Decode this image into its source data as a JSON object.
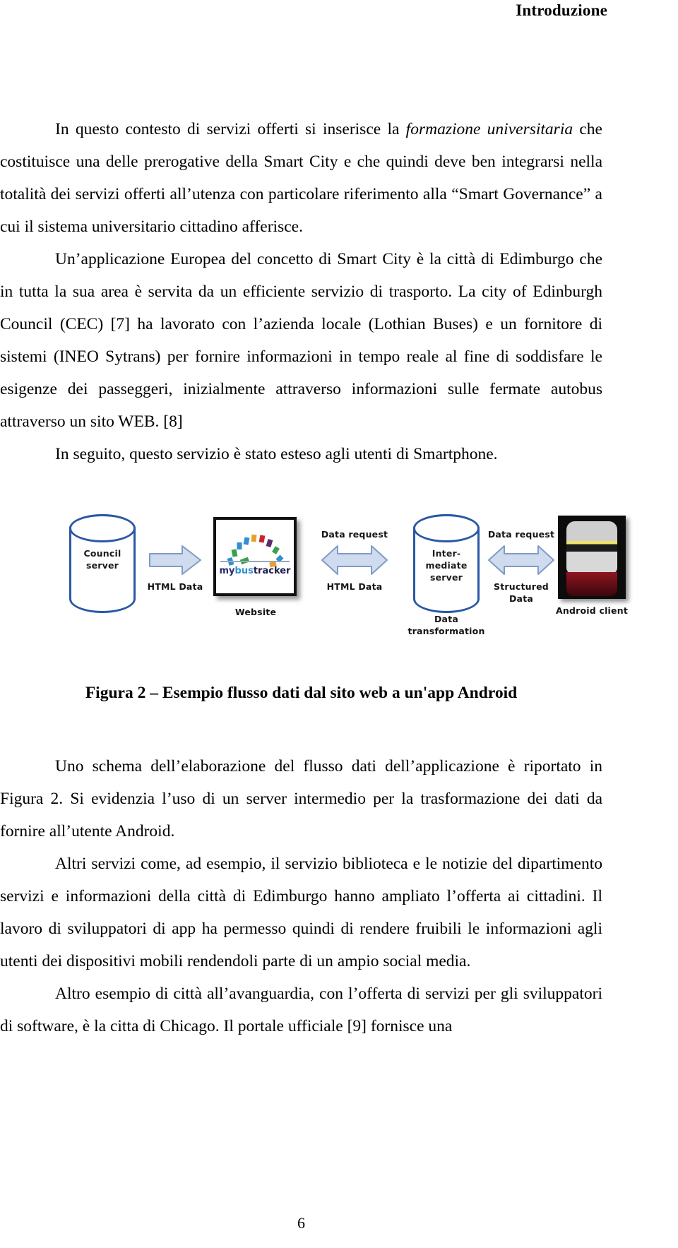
{
  "header": {
    "title": "Introduzione"
  },
  "main": {
    "paragraphs": [
      {
        "id": "p1",
        "indent": true,
        "runs": [
          {
            "text": "In questo contesto di servizi offerti si inserisce la ",
            "style": "normal"
          },
          {
            "text": "formazione universitaria",
            "style": "italic"
          },
          {
            "text": " che costituisce una delle prerogative della Smart City e che quindi deve ben integrarsi nella totalità dei servizi offerti all’utenza con particolare riferimento alla “Smart Governance” a cui il sistema universitario cittadino afferisce.",
            "style": "normal"
          }
        ]
      },
      {
        "id": "p2",
        "indent": true,
        "runs": [
          {
            "text": "Un’applicazione Europea del concetto di Smart City è la città di Edimburgo che in tutta la sua area è servita da un efficiente servizio di trasporto. La city of Edinburgh Council (CEC) [7] ha lavorato con l’azienda locale (Lothian Buses) e un fornitore di sistemi (INEO Sytrans) per fornire informazioni in tempo reale al fine di soddisfare le esigenze dei passeggeri, inizialmente attraverso informazioni sulle fermate autobus attraverso un sito WEB. [8]",
            "style": "normal"
          }
        ]
      },
      {
        "id": "p3",
        "indent": true,
        "runs": [
          {
            "text": "In seguito, questo servizio è stato esteso agli utenti di Smartphone.",
            "style": "normal"
          }
        ]
      }
    ]
  },
  "figure": {
    "caption": "Figura 2 – Esempio flusso dati dal sito web a un'app Android",
    "nodes": {
      "council_server": "Council\nserver",
      "website_label": "Website",
      "intermediate_server": "Inter-\nmediate\nserver",
      "android_client": "Android client",
      "data_transformation": "Data\ntransformation",
      "logo_my": "my",
      "logo_bus": "bus",
      "logo_tracker": "tracker"
    },
    "edges": {
      "edge1_below": "HTML Data",
      "edge2_above": "Data request",
      "edge2_below": "HTML Data",
      "edge3_above": "Data request",
      "edge3_below": "Structured\nData"
    },
    "colors": {
      "cylinder_stroke": "#2a58a5",
      "arrow_fill": "#cfdcef",
      "arrow_stroke": "#7e9cc4",
      "logo_blue": "#2f8fd0",
      "logo_navy": "#2b2b6e"
    }
  },
  "main2": {
    "paragraphs": [
      {
        "id": "p4",
        "indent": true,
        "runs": [
          {
            "text": "Uno schema dell’elaborazione del flusso dati dell’applicazione è riportato in Figura 2. Si evidenzia l’uso di un server intermedio per la trasformazione dei dati da fornire all’utente Android.",
            "style": "normal"
          }
        ]
      },
      {
        "id": "p5",
        "indent": true,
        "runs": [
          {
            "text": "Altri servizi come, ad esempio, il servizio biblioteca e le notizie del dipartimento servizi e informazioni della città di Edimburgo hanno ampliato l’offerta ai cittadini. Il lavoro di sviluppatori di app ha permesso quindi di rendere fruibili le informazioni agli utenti dei dispositivi mobili rendendoli parte di un ampio social media.",
            "style": "normal"
          }
        ]
      },
      {
        "id": "p6",
        "indent": true,
        "runs": [
          {
            "text": "Altro esempio di città all’avanguardia, con l’offerta di servizi per gli sviluppatori di software, è la citta di Chicago. Il portale ufficiale [9] fornisce una",
            "style": "normal"
          }
        ]
      }
    ]
  },
  "footer": {
    "page_number": "6"
  }
}
